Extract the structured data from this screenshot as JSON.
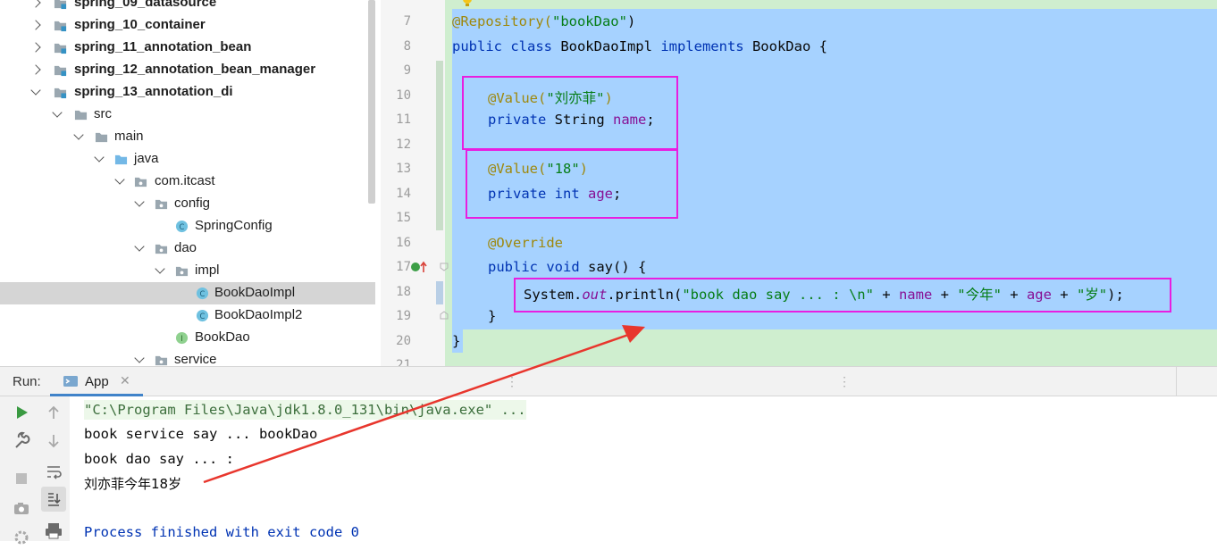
{
  "tree": {
    "items": [
      {
        "label": "spring_09_datasource"
      },
      {
        "label": "spring_10_container"
      },
      {
        "label": "spring_11_annotation_bean"
      },
      {
        "label": "spring_12_annotation_bean_manager"
      },
      {
        "label": "spring_13_annotation_di"
      },
      {
        "label": "src"
      },
      {
        "label": "main"
      },
      {
        "label": "java"
      },
      {
        "label": "com.itcast"
      },
      {
        "label": "config"
      },
      {
        "label": "SpringConfig"
      },
      {
        "label": "dao"
      },
      {
        "label": "impl"
      },
      {
        "label": "BookDaoImpl"
      },
      {
        "label": "BookDaoImpl2"
      },
      {
        "label": "BookDao"
      },
      {
        "label": "service"
      }
    ]
  },
  "editor": {
    "line_numbers": [
      "7",
      "8",
      "9",
      "10",
      "11",
      "12",
      "13",
      "14",
      "15",
      "16",
      "17",
      "18",
      "19",
      "20",
      "21"
    ],
    "code": {
      "l7_ann": "@Repository(",
      "l7_str": "\"bookDao\"",
      "l7_end": ")",
      "l8_kw1": "public class",
      "l8_name": " BookDaoImpl ",
      "l8_kw2": "implements",
      "l8_rest": " BookDao {",
      "l10_ann": "@Value(",
      "l10_str": "\"刘亦菲\"",
      "l10_end": ")",
      "l11_kw": "private",
      "l11_type": " String ",
      "l11_field": "name",
      "l11_end": ";",
      "l13_ann": "@Value(",
      "l13_str": "\"18\"",
      "l13_end": ")",
      "l14_kw": "private int",
      "l14_field": " age",
      "l14_end": ";",
      "l16_ann": "@Override",
      "l17_kw": "public void",
      "l17_rest": " say() {",
      "l18_a": "System.",
      "l18_out": "out",
      "l18_b": ".println(",
      "l18_s1": "\"book dao say ... : \\n\"",
      "l18_c": " + ",
      "l18_f1": "name",
      "l18_d": " + ",
      "l18_s2": "\"今年\"",
      "l18_e": " + ",
      "l18_f2": "age",
      "l18_g": " + ",
      "l18_s3": "\"岁\"",
      "l18_h": ");",
      "l19": "}",
      "l20": "}"
    }
  },
  "run": {
    "label": "Run:",
    "tab": "App",
    "output": [
      "\"C:\\Program Files\\Java\\jdk1.8.0_131\\bin\\java.exe\" ...",
      "book service say ... bookDao",
      "book dao say ... :",
      "刘亦菲今年18岁",
      "",
      "Process finished with exit code 0"
    ]
  },
  "colors": {
    "selection": "#a6d2ff",
    "highlight_box": "#e81ee0",
    "arrow": "#e8362d",
    "tab_underline": "#4083c9"
  }
}
